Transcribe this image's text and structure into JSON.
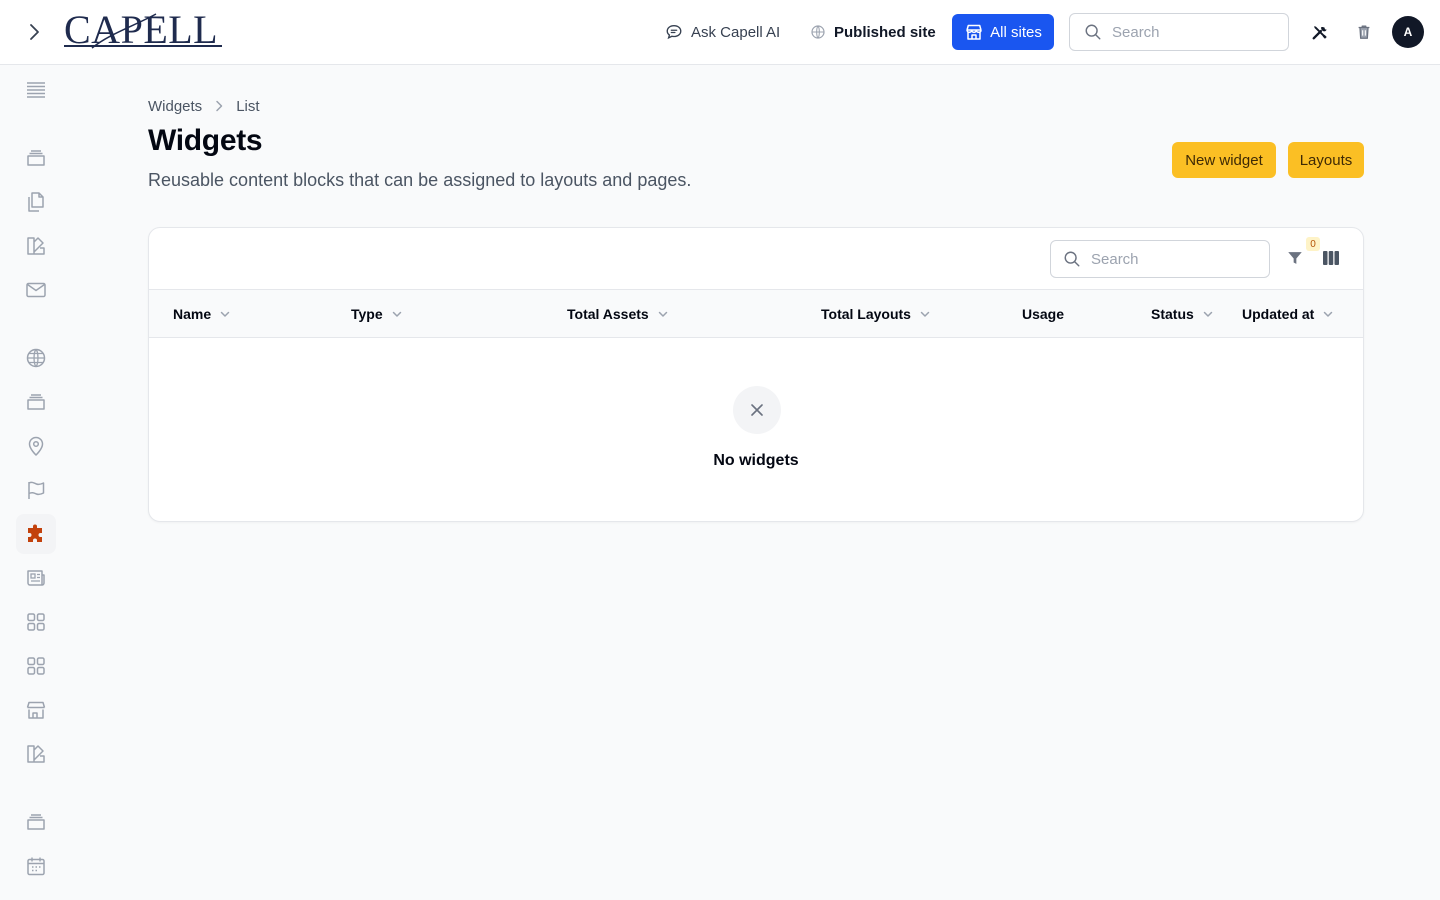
{
  "header": {
    "logo_text": "CAPELL",
    "ask_ai": "Ask Capell AI",
    "published_site": "Published site",
    "all_sites": "All sites",
    "search_placeholder": "Search",
    "avatar_initial": "A"
  },
  "sidebar": {
    "items": [
      {
        "icon": "menu-lines-icon"
      },
      {
        "icon": "stack-icon"
      },
      {
        "icon": "documents-icon"
      },
      {
        "icon": "palette-icon"
      },
      {
        "icon": "mail-icon"
      },
      {
        "icon": "globe-icon"
      },
      {
        "icon": "stack-icon"
      },
      {
        "icon": "map-pin-icon"
      },
      {
        "icon": "flag-icon"
      },
      {
        "icon": "puzzle-icon",
        "active": true
      },
      {
        "icon": "newspaper-icon"
      },
      {
        "icon": "grid-icon"
      },
      {
        "icon": "grid-icon"
      },
      {
        "icon": "storefront-icon"
      },
      {
        "icon": "palette-icon"
      },
      {
        "icon": "stack-icon"
      },
      {
        "icon": "calendar-icon"
      }
    ]
  },
  "breadcrumb": {
    "parent": "Widgets",
    "current": "List"
  },
  "page": {
    "title": "Widgets",
    "subtitle": "Reusable content blocks that can be assigned to layouts and pages.",
    "new_widget": "New widget",
    "layouts": "Layouts"
  },
  "table": {
    "search_placeholder": "Search",
    "filter_count": "0",
    "columns": [
      {
        "label": "Name",
        "sortable": true
      },
      {
        "label": "Type",
        "sortable": true
      },
      {
        "label": "Total Assets",
        "sortable": true
      },
      {
        "label": "Total Layouts",
        "sortable": true
      },
      {
        "label": "Usage",
        "sortable": false
      },
      {
        "label": "Status",
        "sortable": true
      },
      {
        "label": "Updated at",
        "sortable": true
      }
    ],
    "empty_text": "No widgets"
  },
  "colors": {
    "primary": "#1a56f0",
    "amber": "#fbbf24",
    "active_icon": "#c2410c"
  }
}
